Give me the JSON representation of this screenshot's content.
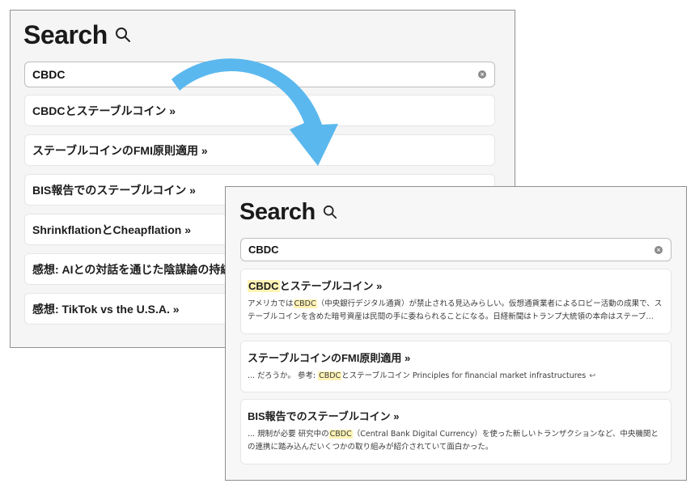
{
  "back_panel": {
    "title": "Search",
    "search_value": "CBDC",
    "results": [
      {
        "title": "CBDCとステーブルコイン »"
      },
      {
        "title": "ステーブルコインのFMI原則適用 »"
      },
      {
        "title": "BIS報告でのステーブルコイン »"
      },
      {
        "title": "ShrinkflationとCheapflation »"
      },
      {
        "title": "感想: AIとの対話を通じた陰謀論の持続的"
      },
      {
        "title": "感想: TikTok vs the U.S.A. »"
      }
    ]
  },
  "front_panel": {
    "title": "Search",
    "search_value": "CBDC",
    "results": [
      {
        "title_highlight": "CBDC",
        "title_rest": "とステーブルコイン »",
        "snippet_pre": "アメリカでは",
        "snippet_hl": "CBDC",
        "snippet_post": "（中央銀行デジタル通貨）が禁止される見込みらしい。仮想通貨業者によるロビー活動の成果で、ステーブルコインを含めた暗号資産は民間の手に委ねられることになる。日経新聞はトランプ大統領の本命はステーブ…"
      },
      {
        "title": "ステーブルコインのFMI原則適用 »",
        "snippet_pre": "... だろうか。 参考: ",
        "snippet_hl": "CBDC",
        "snippet_post": "とステーブルコイン Principles for financial market infrastructures",
        "snippet_glyph": "↩"
      },
      {
        "title": "BIS報告でのステーブルコイン »",
        "snippet_pre": "... 規制が必要 研究中の",
        "snippet_hl": "CBDC",
        "snippet_post": "（Central Bank Digital Currency）を使った新しいトランザクションなど、中央機関との連携に踏み込んだいくつかの取り組みが紹介されていて面白かった。"
      }
    ]
  },
  "icons": {
    "search": "search-icon",
    "clear": "clear-icon",
    "arrow": "curved-arrow-icon"
  },
  "colors": {
    "highlight": "#fff3b5",
    "arrow": "#5bb8ee"
  }
}
